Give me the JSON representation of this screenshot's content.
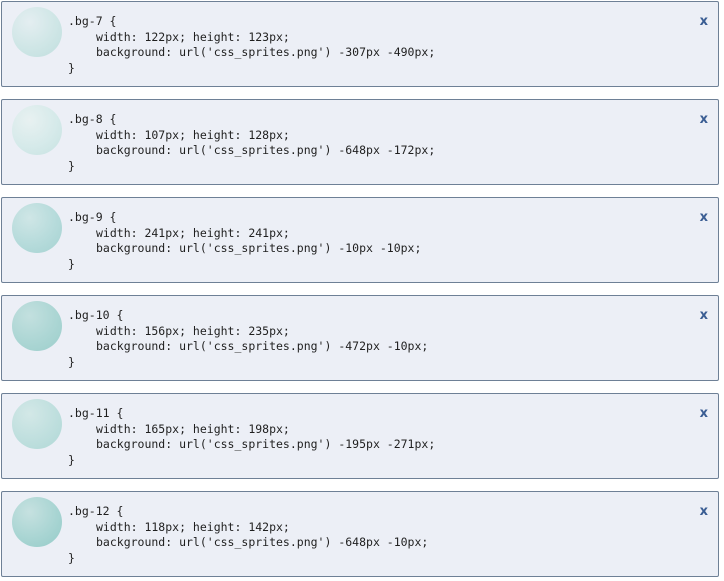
{
  "close_label": "x",
  "colors": {
    "card_background": "#eceff6",
    "card_border": "#6e8096",
    "close_icon": "#3a5d93",
    "code_text": "#1f1f1f"
  },
  "cards": [
    {
      "selector": ".bg-7 {",
      "size": "width: 122px; height: 123px;",
      "background": "background: url('css_sprites.png') -307px -490px;",
      "close": "}",
      "thumb_colors": [
        "#e4eef1",
        "#cfe6e6",
        "#bfdede"
      ]
    },
    {
      "selector": ".bg-8 {",
      "size": "width: 107px; height: 128px;",
      "background": "background: url('css_sprites.png') -648px -172px;",
      "close": "}",
      "thumb_colors": [
        "#e8f1f1",
        "#d6eaea",
        "#c6e2e1"
      ]
    },
    {
      "selector": ".bg-9 {",
      "size": "width: 241px; height: 241px;",
      "background": "background: url('css_sprites.png') -10px -10px;",
      "close": "}",
      "thumb_colors": [
        "#cfe6e6",
        "#b6dbdb",
        "#a4d2d1"
      ]
    },
    {
      "selector": ".bg-10 {",
      "size": "width: 156px; height: 235px;",
      "background": "background: url('css_sprites.png') -472px -10px;",
      "close": "}",
      "thumb_colors": [
        "#c3e0df",
        "#acd6d4",
        "#9bcecb"
      ]
    },
    {
      "selector": ".bg-11 {",
      "size": "width: 165px; height: 198px;",
      "background": "background: url('css_sprites.png') -195px -271px;",
      "close": "}",
      "thumb_colors": [
        "#d3e8e7",
        "#bfdfde",
        "#afd8d6"
      ]
    },
    {
      "selector": ".bg-12 {",
      "size": "width: 118px; height: 142px;",
      "background": "background: url('css_sprites.png') -648px -10px;",
      "close": "}",
      "thumb_colors": [
        "#c6e1e0",
        "#a9d5d3",
        "#94cbc8"
      ]
    }
  ]
}
